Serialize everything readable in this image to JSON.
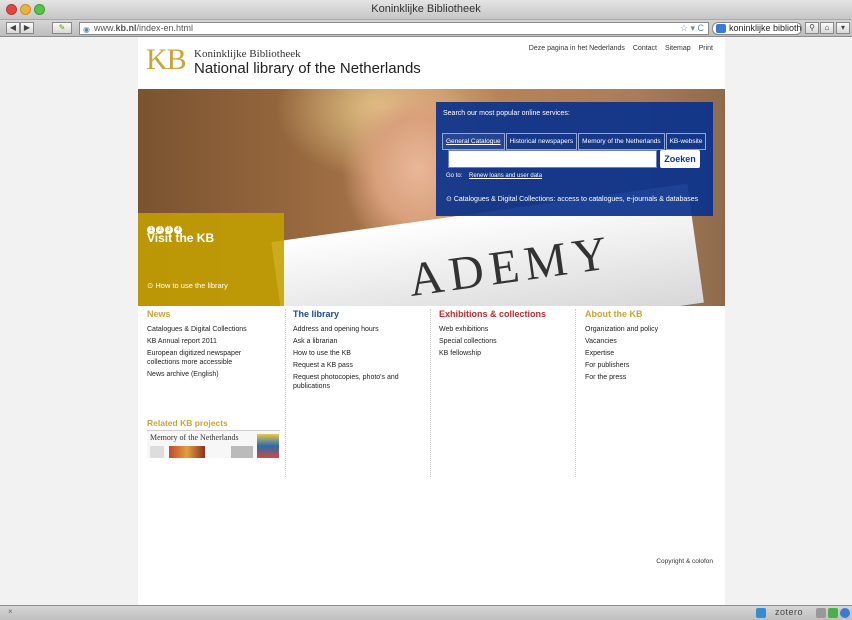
{
  "window": {
    "title": "Koninklijke Bibliotheek"
  },
  "browser": {
    "url_prefix": "www.",
    "url_domain": "kb.nl",
    "url_path": "/index-en.html",
    "search_value": "koninklijke bibliotheek",
    "back_icon": "back-arrow-icon",
    "forward_icon": "forward-arrow-icon"
  },
  "toplinks": [
    "Deze pagina in het Nederlands",
    "Contact",
    "Sitemap",
    "Print"
  ],
  "logo": {
    "mark": "KB",
    "small": "Koninklijke Bibliotheek",
    "big": "National library of the Netherlands"
  },
  "hero": {
    "book_text": "ADEMY",
    "dots": [
      "1",
      "2",
      "3",
      "4"
    ],
    "visit_title": "Visit the KB",
    "visit_link": "How to use the library"
  },
  "services": {
    "title": "Search our most popular online services:",
    "tabs": [
      "General Catalogue",
      "Historical newspapers",
      "Memory of the Netherlands",
      "KB-website"
    ],
    "search_value": "",
    "button": "Zoeken",
    "goto_label": "Go to:",
    "goto_link": "Renew loans and user data",
    "catalog_link": "Catalogues & Digital Collections: access to catalogues, e-journals & databases"
  },
  "columns": [
    {
      "title": "News",
      "color": "#c8a43a",
      "items": [
        "Catalogues & Digital Collections",
        "KB Annual report 2011",
        "European digitized newspaper collections more accessible",
        "News archive (English)"
      ]
    },
    {
      "title": "The library",
      "color": "#1a4a9a",
      "items": [
        "Address and opening hours",
        "Ask a librarian",
        "How to use the KB",
        "Request a KB pass",
        "Request photocopies, photo's and publications"
      ]
    },
    {
      "title": "Exhibitions & collections",
      "color": "#b03030",
      "items": [
        "Web exhibitions",
        "Special collections",
        "KB fellowship"
      ]
    },
    {
      "title": "About the KB",
      "color": "#c8a43a",
      "items": [
        "Organization and policy",
        "Vacancies",
        "Expertise",
        "For publishers",
        "For the press"
      ]
    }
  ],
  "related": {
    "title": "Related KB projects",
    "memory_title": "Memory of the Netherlands"
  },
  "footer": {
    "copyright": "Copyright & colofon"
  },
  "statusbar": {
    "left": "×",
    "zotero": "zotero"
  }
}
